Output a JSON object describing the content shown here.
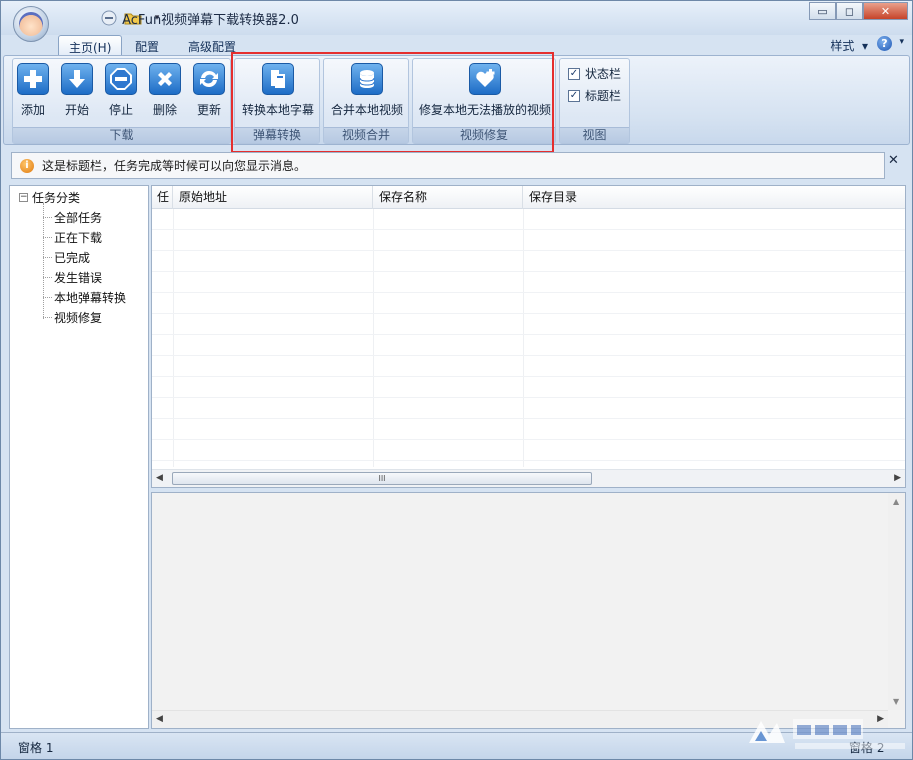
{
  "window": {
    "title": "AcFun视频弹幕下载转换器2.0",
    "controls": {
      "minimize": "▭",
      "restore": "◻",
      "close": "✕"
    }
  },
  "tabs": [
    {
      "label": "主页(H)",
      "active": true
    },
    {
      "label": "配置",
      "active": false
    },
    {
      "label": "高级配置",
      "active": false
    }
  ],
  "style_menu": {
    "label": "样式",
    "arrow": "▾"
  },
  "help": {
    "label": "?",
    "arrow": "▾"
  },
  "ribbon": {
    "download_group": {
      "label": "下载",
      "buttons": [
        {
          "label": "添加",
          "icon": "plus-icon"
        },
        {
          "label": "开始",
          "icon": "arrow-down-icon"
        },
        {
          "label": "停止",
          "icon": "stop-icon"
        },
        {
          "label": "删除",
          "icon": "x-icon"
        },
        {
          "label": "更新",
          "icon": "refresh-icon"
        }
      ]
    },
    "danmaku_group": {
      "label": "弹幕转换",
      "button": {
        "label": "转换本地字幕",
        "icon": "document-icon"
      }
    },
    "merge_group": {
      "label": "视频合并",
      "button": {
        "label": "合并本地视频",
        "icon": "database-icon"
      }
    },
    "repair_group": {
      "label": "视频修复",
      "button": {
        "label": "修复本地无法播放的视频",
        "icon": "heart-plus-icon"
      }
    },
    "view_group": {
      "label": "视图",
      "checks": [
        {
          "label": "状态栏",
          "checked": true
        },
        {
          "label": "标题栏",
          "checked": true
        }
      ]
    }
  },
  "message_bar": {
    "text": "这是标题栏，任务完成等时候可以向您显示消息。",
    "icon": "info-icon",
    "close": "✕"
  },
  "tree": {
    "root": "任务分类",
    "children": [
      "全部任务",
      "正在下载",
      "已完成",
      "发生错误",
      "本地弹幕转换",
      "视频修复"
    ]
  },
  "grid": {
    "columns": [
      "任",
      "原始地址",
      "保存名称",
      "保存目录"
    ],
    "scroll_thumb": "III"
  },
  "status_bar": {
    "left": "窗格 1",
    "right": "窗格 2"
  },
  "colors": {
    "highlight": "#e52e2e",
    "ribbon_icon": "#1d6cc6",
    "info_icon": "#e07a10"
  }
}
